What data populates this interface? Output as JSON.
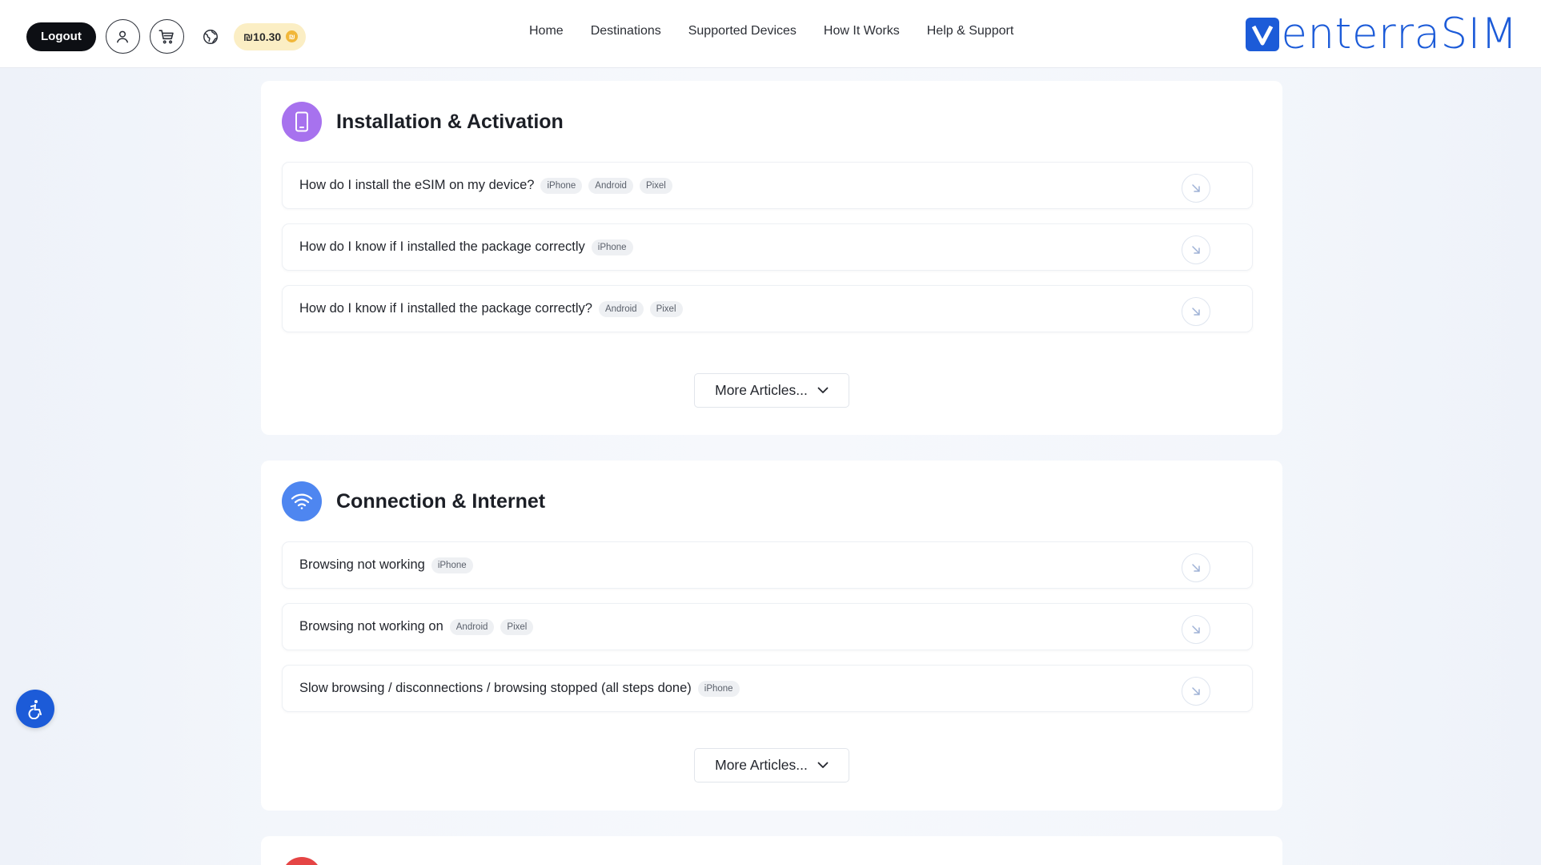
{
  "header": {
    "logout_label": "Logout",
    "credit": "₪10.30",
    "nav": [
      "Home",
      "Destinations",
      "Supported Devices",
      "How It Works",
      "Help & Support"
    ],
    "brand": {
      "mark": "V",
      "text": "enterraSIM"
    }
  },
  "sections": [
    {
      "title": "Installation & Activation",
      "icon": "phone-icon",
      "icon_color": "#a772ee",
      "articles": [
        {
          "title": "How do I install the eSIM on my device?",
          "tags": [
            "iPhone",
            "Android",
            "Pixel"
          ]
        },
        {
          "title": "How do I know if I installed the package correctly",
          "tags": [
            "iPhone"
          ]
        },
        {
          "title": "How do I know if I installed the package correctly?",
          "tags": [
            "Android",
            "Pixel"
          ]
        }
      ],
      "more_label": "More Articles..."
    },
    {
      "title": "Connection & Internet",
      "icon": "wifi-icon",
      "icon_color": "#4e86f0",
      "articles": [
        {
          "title": "Browsing not working",
          "tags": [
            "iPhone"
          ]
        },
        {
          "title": "Browsing not working on",
          "tags": [
            "Android",
            "Pixel"
          ]
        },
        {
          "title": "Slow browsing / disconnections / browsing stopped (all steps done)",
          "tags": [
            "iPhone"
          ]
        }
      ],
      "more_label": "More Articles..."
    },
    {
      "title": "",
      "icon": "section-icon",
      "icon_color": "#e54545",
      "articles": []
    }
  ],
  "colors": {
    "brand": "#1c5bd8",
    "credit_bg": "#fbeec4",
    "coin": "#f1b73a"
  }
}
